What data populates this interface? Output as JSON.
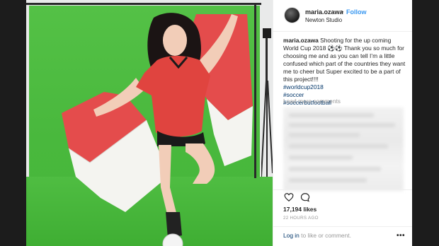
{
  "post": {
    "username": "maria.ozawa",
    "separator": "•",
    "follow_label": "Follow",
    "location": "Newton Studio",
    "caption_user": "maria.ozawa",
    "caption_text": "Shooting for the up coming World Cup 2018 ⚽⚽ Thank you so much for choosing me and as you can tell I’m a little confused which part of the countries they want me to cheer but Super excited to be a part of this project!!!!",
    "hashtags": [
      "#worldcup2018",
      "#soccer",
      "#soccerbutfootball"
    ],
    "load_more_label": "Load more comments",
    "likes": "17,194 likes",
    "timestamp": "22 HOURS AGO",
    "login_link": "Log in",
    "login_suffix": " to like or comment.",
    "more_options": "•••"
  },
  "icons": {
    "heart": "heart-icon",
    "comment": "comment-icon",
    "avatar": "profile-avatar"
  },
  "colors": {
    "link_blue": "#3897f0",
    "hashtag_blue": "#003569",
    "text_dark": "#262626",
    "text_muted": "#999999",
    "green_screen": "#4fbd42",
    "flag_red": "#e44c4c",
    "jersey_red": "#e0443f"
  }
}
